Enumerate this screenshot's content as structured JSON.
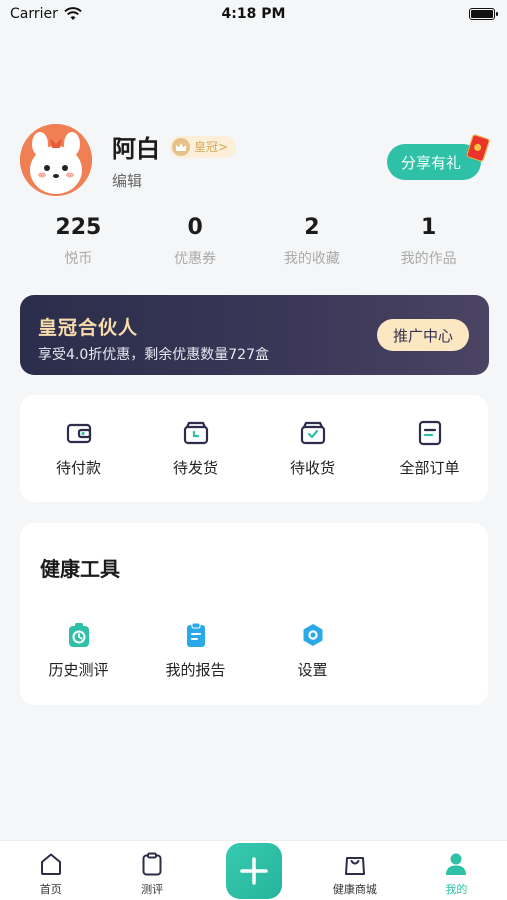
{
  "status_bar": {
    "carrier": "Carrier",
    "time": "4:18 PM"
  },
  "profile": {
    "name": "阿白",
    "level_badge": "皇冠>",
    "edit_label": "编辑",
    "share_label": "分享有礼"
  },
  "stats": [
    {
      "value": "225",
      "label": "悦币"
    },
    {
      "value": "0",
      "label": "优惠券"
    },
    {
      "value": "2",
      "label": "我的收藏"
    },
    {
      "value": "1",
      "label": "我的作品"
    }
  ],
  "partner": {
    "title": "皇冠合伙人",
    "subtitle": "享受4.0折优惠，剩余优惠数量727盒",
    "button_label": "推广中心"
  },
  "orders": [
    {
      "label": "待付款",
      "icon": "wallet-icon"
    },
    {
      "label": "待发货",
      "icon": "box-pending-icon"
    },
    {
      "label": "待收货",
      "icon": "box-check-icon"
    },
    {
      "label": "全部订单",
      "icon": "order-list-icon"
    }
  ],
  "tools": {
    "title": "健康工具",
    "items": [
      {
        "label": "历史测评",
        "icon": "history-clock-icon"
      },
      {
        "label": "我的报告",
        "icon": "report-icon"
      },
      {
        "label": "设置",
        "icon": "settings-icon"
      }
    ]
  },
  "tabs": [
    {
      "label": "首页",
      "icon": "home-icon"
    },
    {
      "label": "测评",
      "icon": "clipboard-icon"
    },
    {
      "label": "健康商城",
      "icon": "shopping-bag-icon"
    },
    {
      "label": "我的",
      "icon": "user-icon"
    }
  ],
  "colors": {
    "accent": "#2fc1a8",
    "banner_dark": "#2a2e4b",
    "banner_gold": "#f8dcab",
    "icon_navy": "#2b2d4a"
  }
}
